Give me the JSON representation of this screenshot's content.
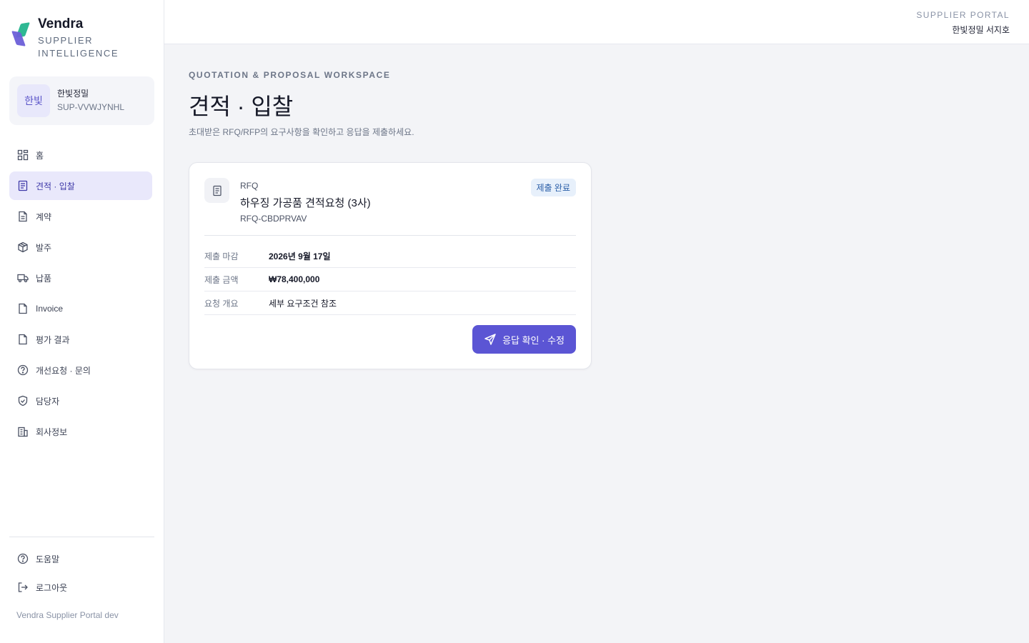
{
  "brand": {
    "name": "Vendra",
    "subtitle": "SUPPLIER INTELLIGENCE"
  },
  "account": {
    "avatar_text": "한빛",
    "company": "한빛정밀",
    "code": "SUP-VVWJYNHL"
  },
  "nav": {
    "items": [
      {
        "label": "홈",
        "icon": "grid-icon"
      },
      {
        "label": "견적 · 입찰",
        "icon": "document-list-icon",
        "active": true
      },
      {
        "label": "계약",
        "icon": "contract-icon"
      },
      {
        "label": "발주",
        "icon": "package-icon"
      },
      {
        "label": "납품",
        "icon": "truck-icon"
      },
      {
        "label": "Invoice",
        "icon": "file-icon"
      },
      {
        "label": "평가 결과",
        "icon": "file-icon"
      },
      {
        "label": "개선요청 · 문의",
        "icon": "question-circle-icon"
      },
      {
        "label": "담당자",
        "icon": "shield-icon"
      },
      {
        "label": "회사정보",
        "icon": "building-icon"
      }
    ],
    "footer": [
      {
        "label": "도움말",
        "icon": "question-circle-icon"
      },
      {
        "label": "로그아웃",
        "icon": "logout-icon"
      }
    ],
    "version": "Vendra Supplier Portal dev"
  },
  "topbar": {
    "portal_label": "SUPPLIER PORTAL",
    "user": "한빛정밀 서지호"
  },
  "page": {
    "eyebrow": "QUOTATION & PROPOSAL WORKSPACE",
    "title": "견적 · 입찰",
    "description": "초대받은 RFQ/RFP의 요구사항을 확인하고 응답을 제출하세요."
  },
  "card": {
    "type": "RFQ",
    "title": "하우징 가공품 견적요청 (3사)",
    "code": "RFQ-CBDPRVAV",
    "status": "제출 완료",
    "rows": [
      {
        "label": "제출 마감",
        "value": "2026년 9월 17일"
      },
      {
        "label": "제출 금액",
        "value": "₩78,400,000"
      },
      {
        "label": "요청 개요",
        "value": "세부 요구조건 참조"
      }
    ],
    "action_label": "응답 확인 · 수정"
  },
  "colors": {
    "accent": "#5b55d4",
    "active_bg": "#e9e8fb",
    "badge_bg": "#e7f0fb",
    "badge_text": "#2b5fa8"
  }
}
